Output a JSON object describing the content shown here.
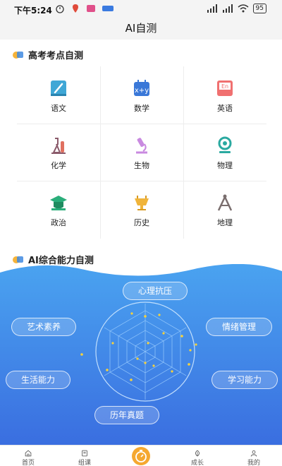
{
  "status_bar": {
    "time": "下午5:24",
    "battery": "95"
  },
  "header": {
    "title": "AI自测"
  },
  "section_exam": {
    "title": "高考考点自测",
    "subjects": [
      {
        "label": "语文",
        "icon": "chinese-book-icon",
        "color": "#3fa7d6"
      },
      {
        "label": "数学",
        "icon": "math-calendar-icon",
        "color": "#3a78d8"
      },
      {
        "label": "英语",
        "icon": "english-book-icon",
        "color": "#f07070"
      },
      {
        "label": "化学",
        "icon": "chemistry-flask-icon",
        "color": "#8a5a6a"
      },
      {
        "label": "生物",
        "icon": "microscope-icon",
        "color": "#c98ae0"
      },
      {
        "label": "物理",
        "icon": "physics-magnet-icon",
        "color": "#2aa9a0"
      },
      {
        "label": "政治",
        "icon": "graduation-cap-icon",
        "color": "#2aae7a"
      },
      {
        "label": "历史",
        "icon": "history-vessel-icon",
        "color": "#f0b43a"
      },
      {
        "label": "地理",
        "icon": "compass-icon",
        "color": "#7a6e6e"
      }
    ]
  },
  "section_ai": {
    "title": "AI综合能力自测",
    "abilities": {
      "psychology": "心理抗压",
      "art": "艺术素养",
      "emotion": "情绪管理",
      "life": "生活能力",
      "study": "学习能力",
      "past_exams": "历年真题"
    }
  },
  "tabbar": {
    "items": [
      "首页",
      "组课",
      "",
      "成长",
      "我的"
    ]
  },
  "colors": {
    "accent": "#3a86e8",
    "wave_top": "#4aa3f0",
    "wave_bottom": "#3a72e0",
    "tab_active": "#f5a830"
  }
}
